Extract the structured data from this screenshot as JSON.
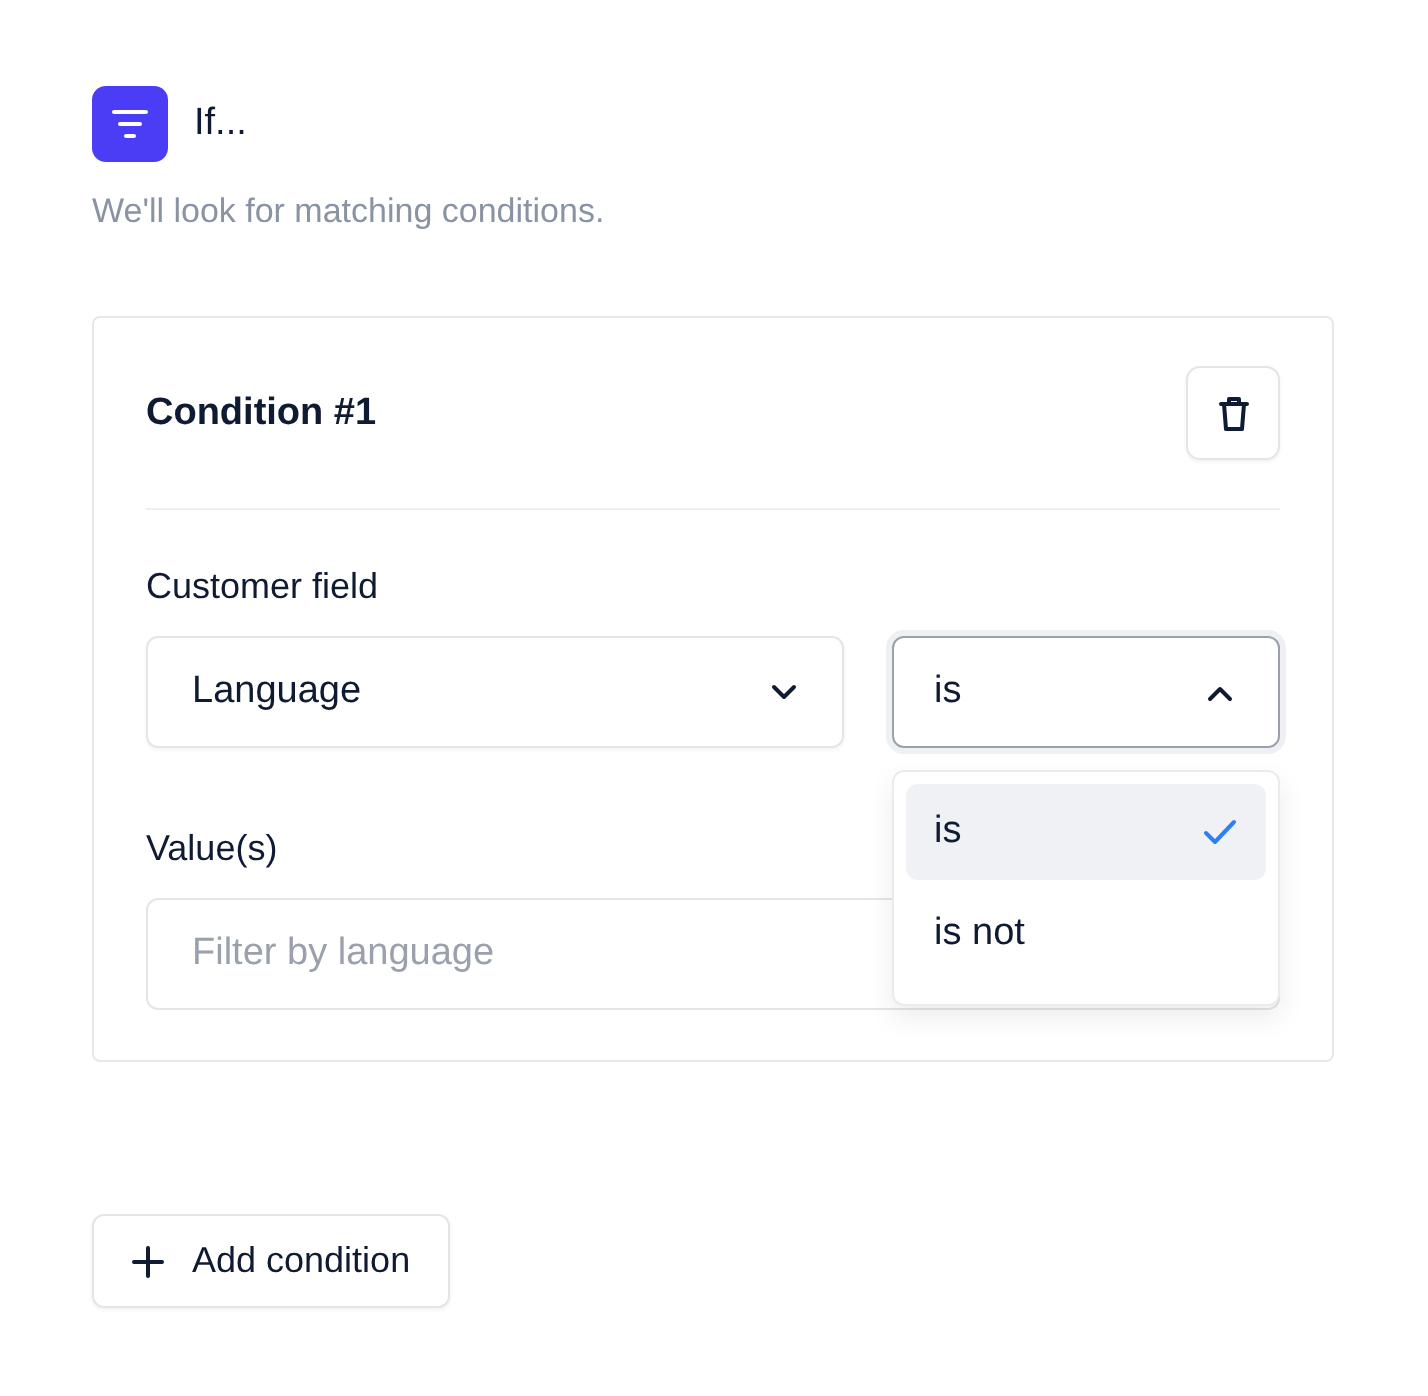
{
  "header": {
    "title": "If...",
    "subtitle": "We'll look for matching conditions."
  },
  "conditions": [
    {
      "title": "Condition #1",
      "field_label": "Customer field",
      "field_select": {
        "value": "Language",
        "open": false
      },
      "operator_select": {
        "value": "is",
        "open": true,
        "options": [
          {
            "label": "is",
            "selected": true
          },
          {
            "label": "is not",
            "selected": false
          }
        ]
      },
      "values_label": "Value(s)",
      "values_input": {
        "placeholder": "Filter by language"
      }
    }
  ],
  "add_button": "Add condition"
}
